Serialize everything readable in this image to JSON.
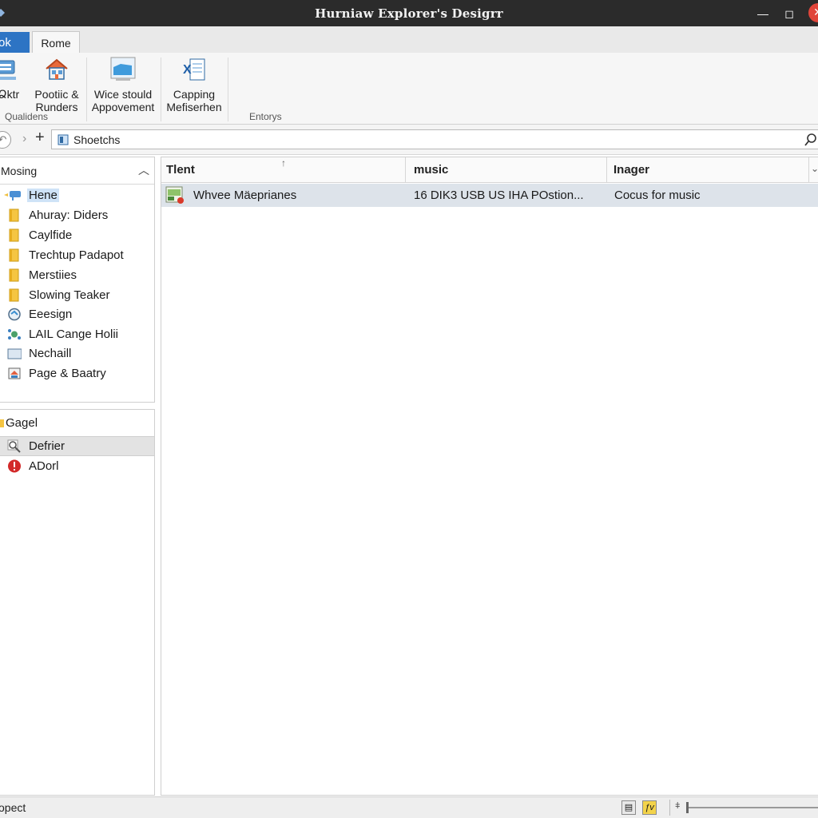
{
  "window": {
    "title": "Hurniaw Explorer's Desigrr",
    "min_glyph": "—",
    "max_glyph": "◻",
    "close_glyph": "✕"
  },
  "ribbon": {
    "tabs": [
      {
        "label": "ok",
        "active": true
      },
      {
        "label": "Rome",
        "active": false
      }
    ],
    "buttons": [
      {
        "label_1": "Ձktr",
        "label_2": "",
        "icon": "network-icon"
      },
      {
        "label_1": "Pootiic &",
        "label_2": "Runders",
        "icon": "house-icon"
      },
      {
        "label_1": "Wice stould",
        "label_2": "Appovement",
        "icon": "monitor-folder-icon"
      },
      {
        "label_1": "Capping",
        "label_2": "Mefiserhen",
        "icon": "excel-icon"
      }
    ],
    "groups": [
      "Qualidens",
      "Entorys"
    ]
  },
  "address": {
    "path": "Shoetchs",
    "back_glyph": "↶",
    "forward_glyph": "›",
    "add_glyph": "+"
  },
  "nav": {
    "header": "Mosing",
    "items": [
      {
        "label": "Hene",
        "icon": "network-drive-icon",
        "selected": true
      },
      {
        "label": "Ahuray: Diders",
        "icon": "folder-icon"
      },
      {
        "label": "Caylfide",
        "icon": "folder-icon"
      },
      {
        "label": "Trechtup Padapot",
        "icon": "folder-icon"
      },
      {
        "label": "Merstiies",
        "icon": "folder-icon"
      },
      {
        "label": "Slowing Teaker",
        "icon": "folder-icon"
      },
      {
        "label": "Eeesign",
        "icon": "globe-icon"
      },
      {
        "label": "LAIL Cange Holii",
        "icon": "gear-network-icon"
      },
      {
        "label": "Nechaill",
        "icon": "drive-icon"
      },
      {
        "label": "Page & Baatry",
        "icon": "page-icon"
      }
    ],
    "group2": {
      "header": "Gagel",
      "items": [
        {
          "label": "Defrier",
          "icon": "magnifier-icon",
          "highlighted": true
        },
        {
          "label": "ADorl",
          "icon": "error-icon"
        }
      ]
    }
  },
  "content": {
    "columns": [
      "Tlent",
      "music",
      "Inager"
    ],
    "sort_glyph": "↑",
    "rows": [
      {
        "name": "Whvee Mäeprianes",
        "music": "16 DIK3 USB US IHA POstion...",
        "inager": "Cocus for music"
      }
    ]
  },
  "status": {
    "text": "opect",
    "details_glyph": "▤",
    "tiles_glyph": "ƒv",
    "zoom_minus": "ǂ",
    "zoom_level": 0
  },
  "colors": {
    "titlebar": "#2b2b2b",
    "accent": "#2d74c4",
    "selection": "#cfe3f7",
    "row_highlight": "#dde3ea",
    "close": "#e0453a"
  }
}
